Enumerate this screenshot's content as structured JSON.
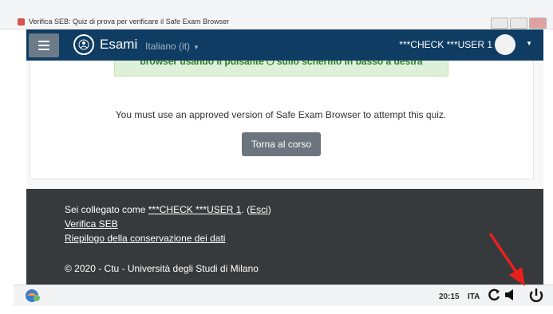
{
  "window": {
    "title": "Verifica SEB: Quiz di prova per verificare il Safe Exam Browser"
  },
  "navbar": {
    "menu_icon": "hamburger-icon",
    "brand": "Esami",
    "language": "Italiano (it)",
    "user": "***CHECK ***USER 1"
  },
  "alert": {
    "text": "browser usando il pulsante ⏻ sullo schermo in basso a destra"
  },
  "main": {
    "message": "You must use an approved version of Safe Exam Browser to attempt this quiz.",
    "back_button": "Torna al corso"
  },
  "footer": {
    "logged_prefix": "Sei collegato come ",
    "logged_user": "***CHECK ***USER 1",
    "logged_sep": ". (",
    "logout": "Esci",
    "logged_close": ")",
    "verify_link": "Verifica SEB",
    "privacy_link": "Riepilogo della conservazione dei dati",
    "copyright": "© 2020 - Ctu - Università degli Studi di Milano"
  },
  "taskbar": {
    "time": "20:15",
    "keyboard": "ITA",
    "icons": [
      "reload-icon",
      "volume-icon",
      "power-icon"
    ]
  },
  "colors": {
    "navbar": "#0f3c63",
    "footer": "#373a3c",
    "alert_bg": "#dff0d8",
    "button": "#6c757d",
    "annotation": "#e8201b"
  }
}
